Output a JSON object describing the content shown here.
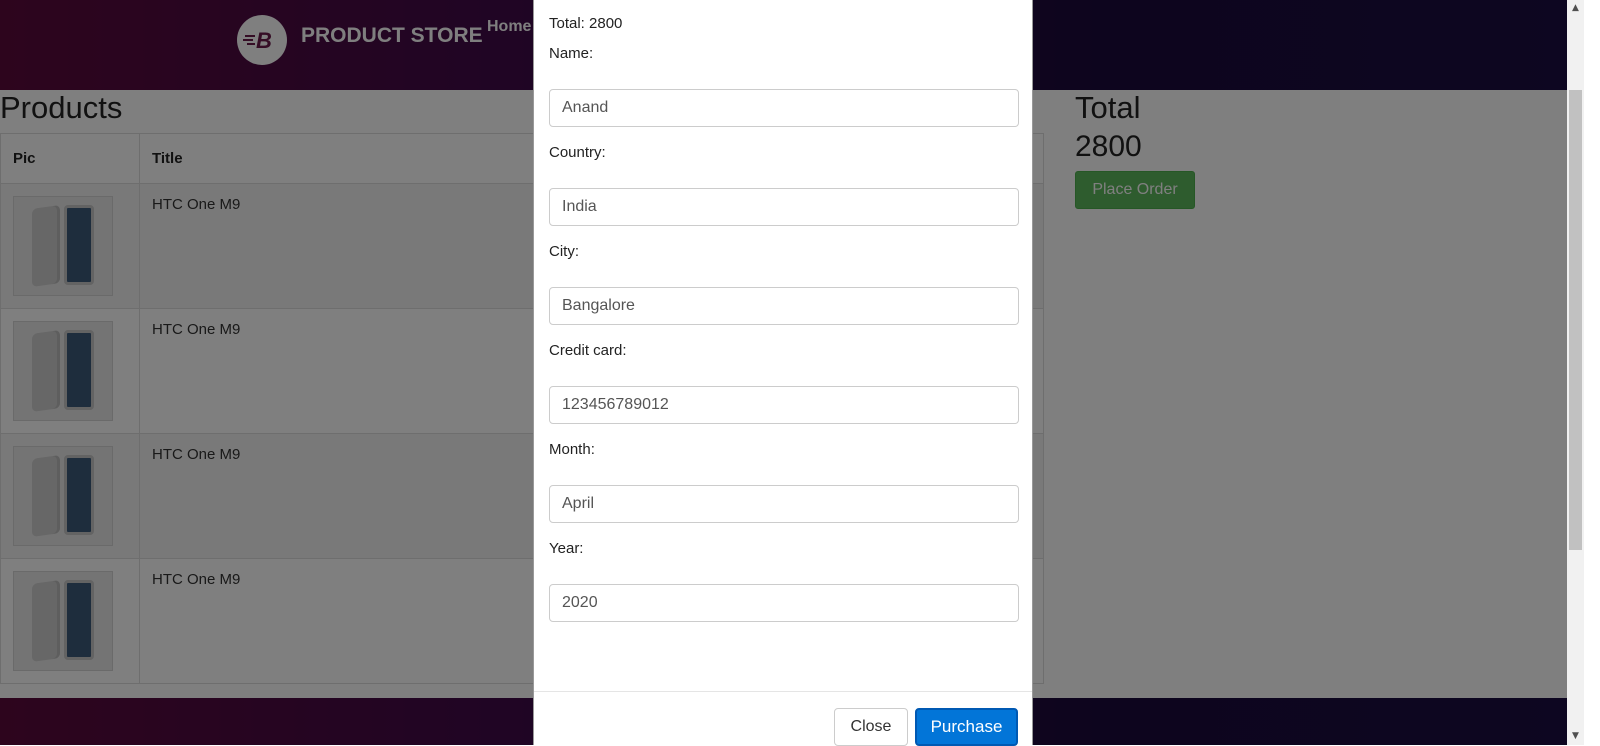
{
  "header": {
    "brand": "PRODUCT STORE",
    "logo_letter": "B",
    "nav_home": "Home"
  },
  "cart": {
    "heading": "Products",
    "columns": [
      "Pic",
      "Title"
    ],
    "rows": [
      {
        "title": "HTC One M9"
      },
      {
        "title": "HTC One M9"
      },
      {
        "title": "HTC One M9"
      },
      {
        "title": "HTC One M9"
      }
    ],
    "total_heading": "Total",
    "total_value": "2800",
    "place_order_label": "Place Order"
  },
  "modal": {
    "total_line": "Total: 2800",
    "fields": [
      {
        "label": "Name:",
        "value": "Anand"
      },
      {
        "label": "Country:",
        "value": "India"
      },
      {
        "label": "City:",
        "value": "Bangalore"
      },
      {
        "label": "Credit card:",
        "value": "123456789012"
      },
      {
        "label": "Month:",
        "value": "April"
      },
      {
        "label": "Year:",
        "value": "2020"
      }
    ],
    "close_label": "Close",
    "purchase_label": "Purchase"
  },
  "colors": {
    "purchase": "#0275d8",
    "place_order": "#5cb85c",
    "nav_gradient_start": "#5b0a3b",
    "nav_gradient_end": "#1a0c42"
  }
}
